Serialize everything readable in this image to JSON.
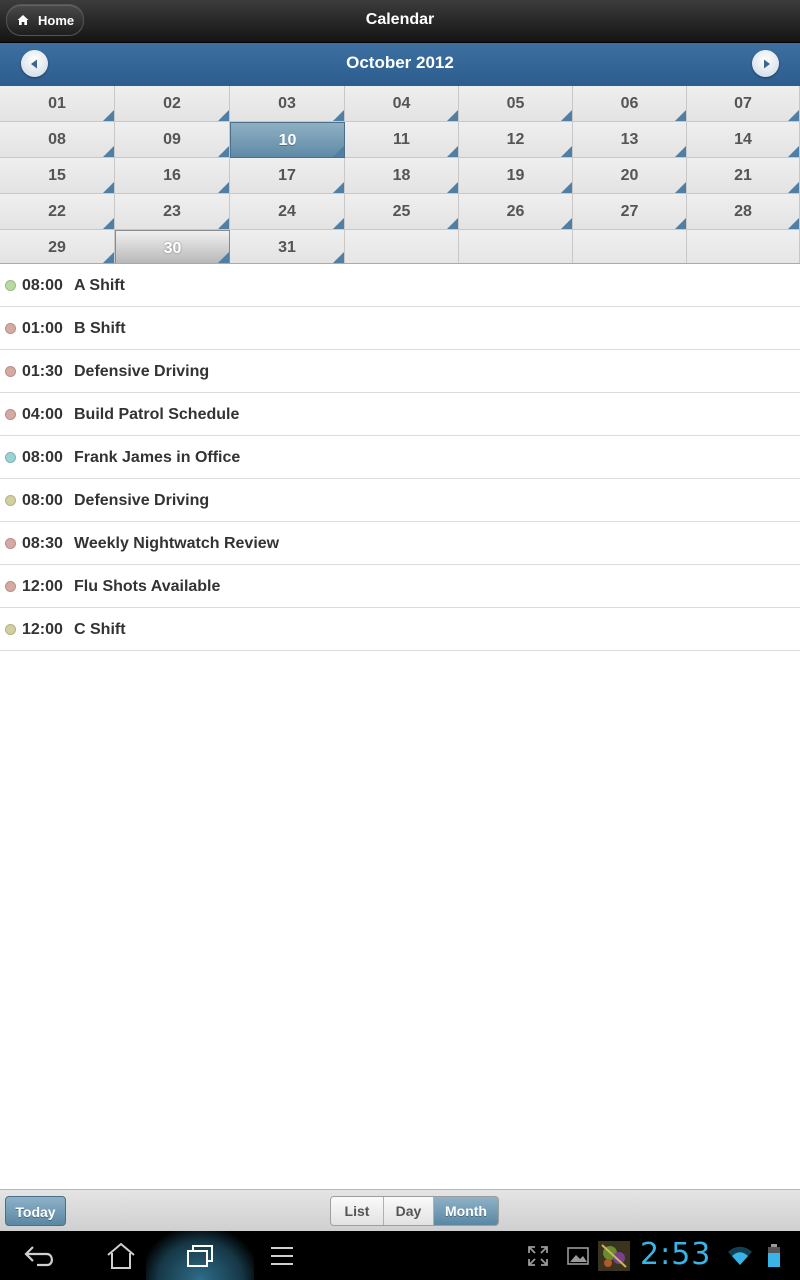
{
  "header": {
    "home_label": "Home",
    "title": "Calendar"
  },
  "month_nav": {
    "title": "October 2012"
  },
  "calendar": {
    "days": [
      {
        "label": "01",
        "events": true
      },
      {
        "label": "02",
        "events": true
      },
      {
        "label": "03",
        "events": true
      },
      {
        "label": "04",
        "events": true
      },
      {
        "label": "05",
        "events": true
      },
      {
        "label": "06",
        "events": true
      },
      {
        "label": "07",
        "events": true
      },
      {
        "label": "08",
        "events": true
      },
      {
        "label": "09",
        "events": true
      },
      {
        "label": "10",
        "events": true,
        "state": "selected"
      },
      {
        "label": "11",
        "events": true
      },
      {
        "label": "12",
        "events": true
      },
      {
        "label": "13",
        "events": true
      },
      {
        "label": "14",
        "events": true
      },
      {
        "label": "15",
        "events": true
      },
      {
        "label": "16",
        "events": true
      },
      {
        "label": "17",
        "events": true
      },
      {
        "label": "18",
        "events": true
      },
      {
        "label": "19",
        "events": true
      },
      {
        "label": "20",
        "events": true
      },
      {
        "label": "21",
        "events": true
      },
      {
        "label": "22",
        "events": true
      },
      {
        "label": "23",
        "events": true
      },
      {
        "label": "24",
        "events": true
      },
      {
        "label": "25",
        "events": true
      },
      {
        "label": "26",
        "events": true
      },
      {
        "label": "27",
        "events": true
      },
      {
        "label": "28",
        "events": true
      },
      {
        "label": "29",
        "events": true
      },
      {
        "label": "30",
        "events": true,
        "state": "today"
      },
      {
        "label": "31",
        "events": true
      },
      {
        "label": ""
      },
      {
        "label": ""
      },
      {
        "label": ""
      },
      {
        "label": ""
      }
    ]
  },
  "events": [
    {
      "time": "08:00",
      "title": "A Shift",
      "color": "#b9d9a0"
    },
    {
      "time": "01:00",
      "title": "B Shift",
      "color": "#d5aaa2"
    },
    {
      "time": "01:30",
      "title": "Defensive Driving",
      "color": "#d5aaa2"
    },
    {
      "time": "04:00",
      "title": "Build Patrol Schedule",
      "color": "#d5aaa2"
    },
    {
      "time": "08:00",
      "title": "Frank James in Office",
      "color": "#99d3d3"
    },
    {
      "time": "08:00",
      "title": "Defensive Driving",
      "color": "#d3cfa0"
    },
    {
      "time": "08:30",
      "title": "Weekly Nightwatch Review",
      "color": "#d5aaa2"
    },
    {
      "time": "12:00",
      "title": "Flu Shots Available",
      "color": "#d5aaa2"
    },
    {
      "time": "12:00",
      "title": "C Shift",
      "color": "#d3cfa0"
    }
  ],
  "toolbar": {
    "today_label": "Today",
    "views": {
      "list": "List",
      "day": "Day",
      "month": "Month"
    },
    "active_view": "Month"
  },
  "system_bar": {
    "clock": "2:53",
    "icons": [
      "back-icon",
      "home-icon",
      "recent-apps-icon",
      "menu-icon",
      "fullscreen-icon",
      "gallery-icon",
      "app-thumbnail-icon",
      "wifi-icon",
      "battery-icon"
    ]
  },
  "colors": {
    "accent": "#2c5d8f",
    "selected_day": "#5f8aa6",
    "event_marker": "#4f7fa5",
    "clock": "#37b5e6"
  }
}
